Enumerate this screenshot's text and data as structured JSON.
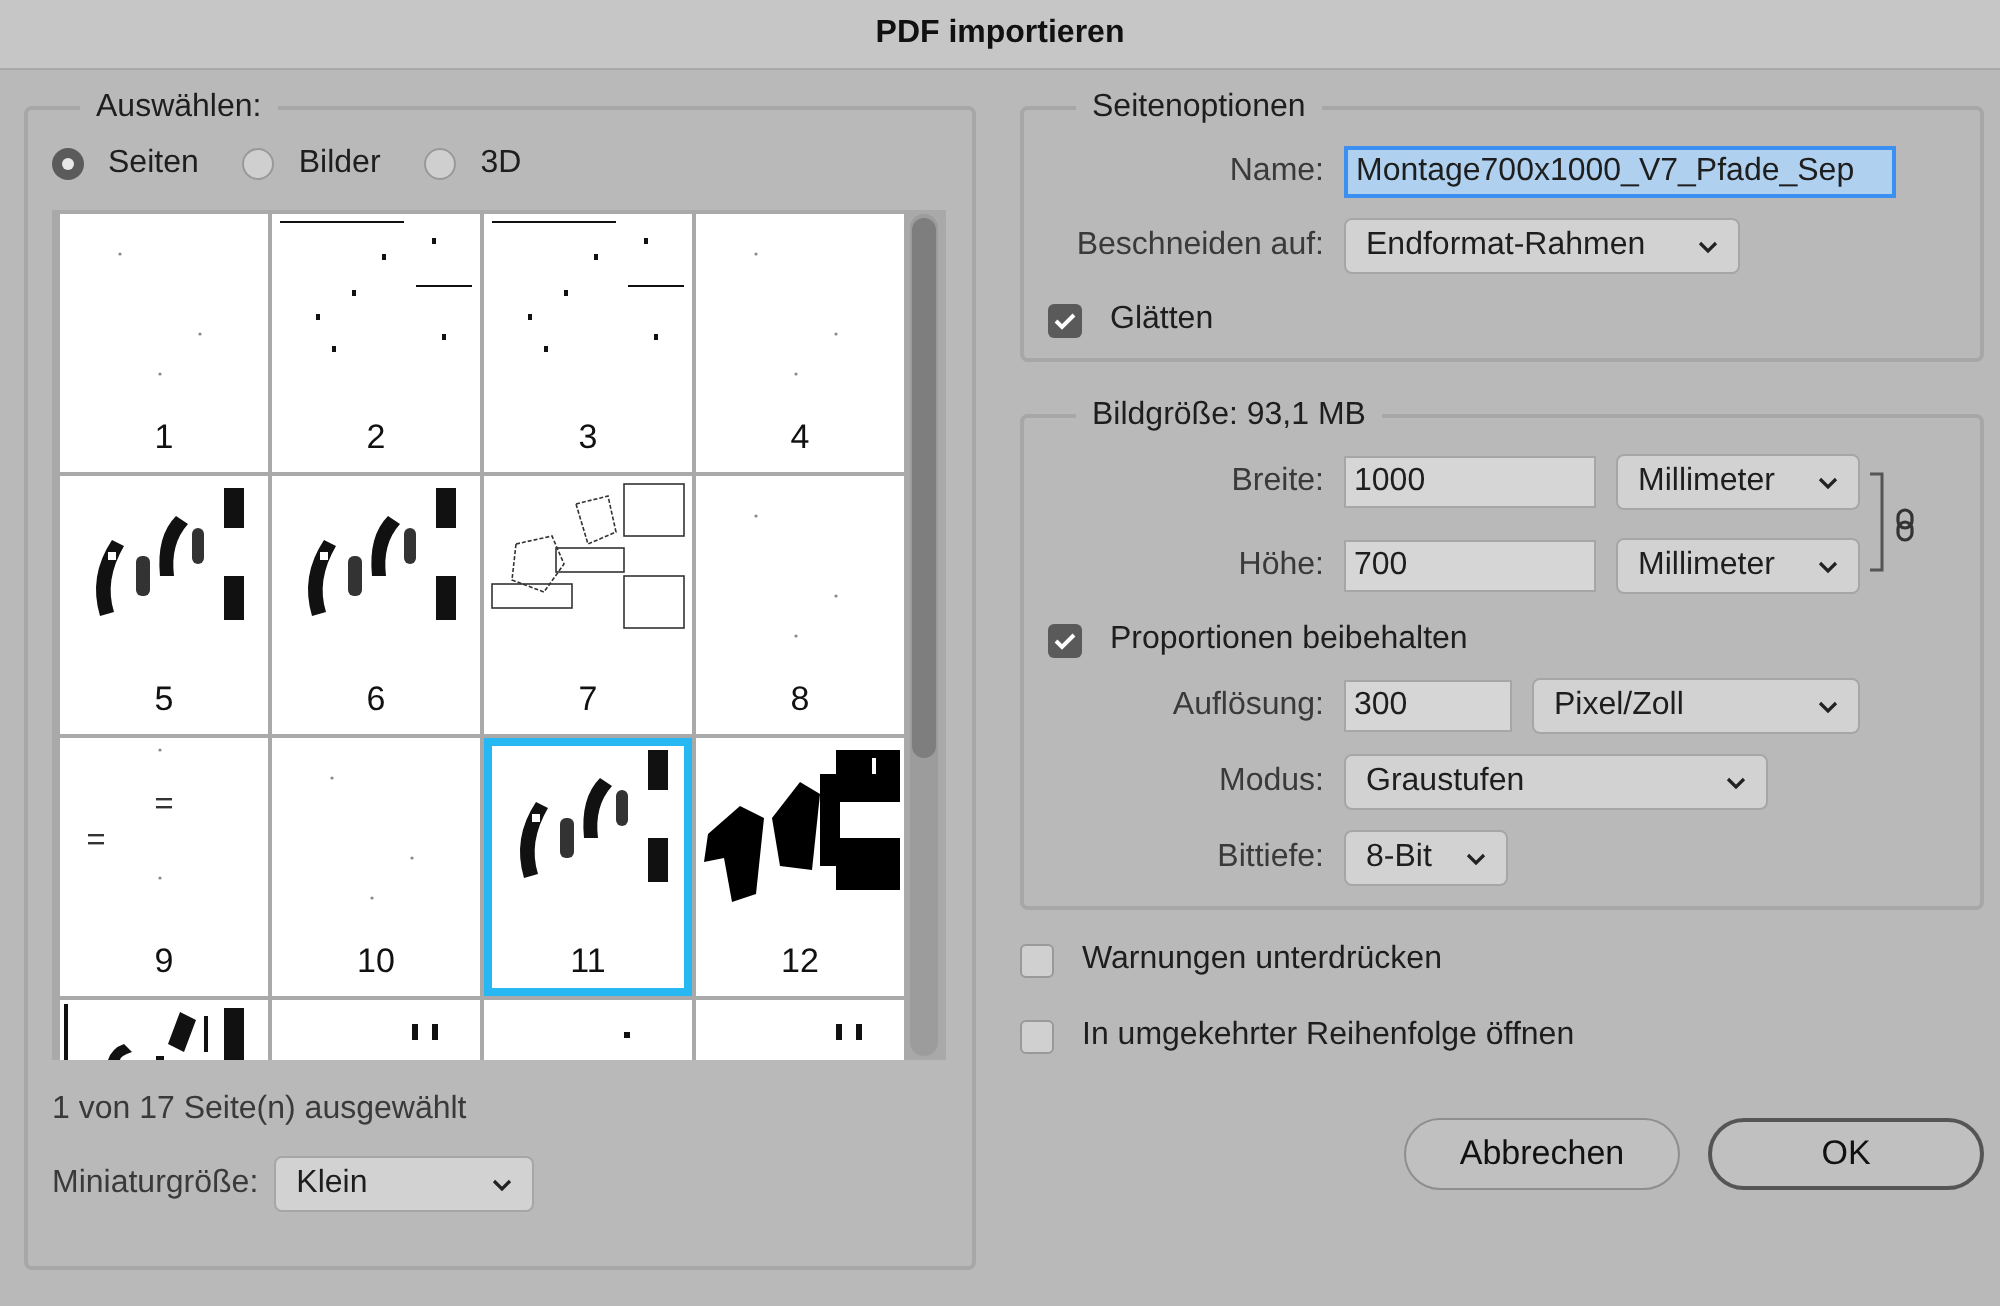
{
  "window": {
    "title": "PDF importieren"
  },
  "selection": {
    "title": "Auswählen:",
    "modes": [
      {
        "label": "Seiten",
        "selected": true
      },
      {
        "label": "Bilder",
        "selected": false
      },
      {
        "label": "3D",
        "selected": false
      }
    ],
    "pages": [
      {
        "number": "1",
        "kind": "blank",
        "selected": false
      },
      {
        "number": "2",
        "kind": "sparse",
        "selected": false
      },
      {
        "number": "3",
        "kind": "sparse",
        "selected": false
      },
      {
        "number": "4",
        "kind": "blank",
        "selected": false
      },
      {
        "number": "5",
        "kind": "dense",
        "selected": false
      },
      {
        "number": "6",
        "kind": "dense",
        "selected": false
      },
      {
        "number": "7",
        "kind": "outline",
        "selected": false
      },
      {
        "number": "8",
        "kind": "blank",
        "selected": false
      },
      {
        "number": "9",
        "kind": "dashes",
        "selected": false
      },
      {
        "number": "10",
        "kind": "blank",
        "selected": false
      },
      {
        "number": "11",
        "kind": "dense",
        "selected": true
      },
      {
        "number": "12",
        "kind": "solid",
        "selected": false
      },
      {
        "kind": "fragment_blocks",
        "selected": false
      },
      {
        "kind": "fragment_marks",
        "selected": false
      },
      {
        "kind": "fragment_dot",
        "selected": false
      },
      {
        "kind": "fragment_marks",
        "selected": false
      }
    ],
    "status": "1 von 17 Seite(n) ausgewählt",
    "thumbnail_size": {
      "label": "Miniaturgröße:",
      "value": "Klein"
    }
  },
  "page_options": {
    "title": "Seitenoptionen",
    "name": {
      "label": "Name:",
      "value": "Montage700x1000_V7_Pfade_Sep"
    },
    "crop": {
      "label": "Beschneiden auf:",
      "value": "Endformat-Rahmen"
    },
    "smooth": {
      "label": "Glätten",
      "checked": true
    }
  },
  "image_size": {
    "title": "Bildgröße: 93,1 MB",
    "width": {
      "label": "Breite:",
      "value": "1000",
      "unit": "Millimeter"
    },
    "height": {
      "label": "Höhe:",
      "value": "700",
      "unit": "Millimeter"
    },
    "constrain": {
      "label": "Proportionen beibehalten",
      "checked": true
    },
    "resolution": {
      "label": "Auflösung:",
      "value": "300",
      "unit": "Pixel/Zoll"
    },
    "mode": {
      "label": "Modus:",
      "value": "Graustufen"
    },
    "bit_depth": {
      "label": "Bittiefe:",
      "value": "8-Bit"
    }
  },
  "options": [
    {
      "label": "Warnungen unterdrücken",
      "checked": false
    },
    {
      "label": "In umgekehrter Reihenfolge öffnen",
      "checked": false
    }
  ],
  "buttons": [
    {
      "label": "Abbrechen",
      "kind": "cancel"
    },
    {
      "label": "OK",
      "kind": "default"
    }
  ]
}
